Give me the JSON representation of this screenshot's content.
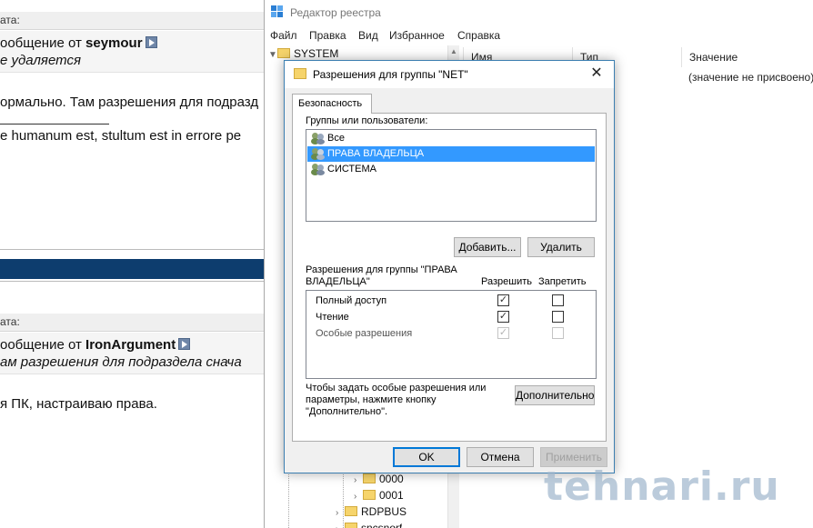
{
  "forum": {
    "post1": {
      "header": "ата:",
      "quote_prefix": "ообщение от",
      "author": "seymour",
      "quote_text": "е удаляется",
      "body": "ормально. Там разрешения для подразд",
      "signature": "е humanum est, stultum est in errore pe"
    },
    "post2": {
      "header": "ата:",
      "quote_prefix": "ообщение от",
      "author": "IronArgument",
      "quote_text": "ам разрешения для подраздела снача",
      "body": "я ПК, настраиваю права."
    }
  },
  "regedit": {
    "title": "Редактор реестра",
    "menu": [
      "Файл",
      "Правка",
      "Вид",
      "Избранное",
      "Справка"
    ],
    "tree": {
      "root": "SYSTEM",
      "items": [
        "0000",
        "0001",
        "RDPBUS",
        "sncsnorf"
      ]
    },
    "columns": [
      "Имя",
      "Тип",
      "Значение"
    ],
    "row_value": "(значение не присвоено)"
  },
  "dialog": {
    "title": "Разрешения для группы \"NET\"",
    "tab": "Безопасность",
    "groups_label": "Группы или пользователи:",
    "groups": [
      {
        "name": "Все",
        "selected": false
      },
      {
        "name": "ПРАВА ВЛАДЕЛЬЦА",
        "selected": true
      },
      {
        "name": "СИСТЕМА",
        "selected": false
      }
    ],
    "add_button": "Добавить...",
    "remove_button": "Удалить",
    "perm_label_line1": "Разрешения для группы \"ПРАВА",
    "perm_label_line2": "ВЛАДЕЛЬЦА\"",
    "allow_label": "Разрешить",
    "deny_label": "Запретить",
    "permissions": [
      {
        "name": "Полный доступ",
        "allow": true,
        "deny": false,
        "enabled": true
      },
      {
        "name": "Чтение",
        "allow": true,
        "deny": false,
        "enabled": true
      },
      {
        "name": "Особые разрешения",
        "allow": true,
        "deny": false,
        "enabled": false
      }
    ],
    "advanced_text_line1": "Чтобы задать особые разрешения или",
    "advanced_text_line2": "параметры, нажмите кнопку",
    "advanced_text_line3": "\"Дополнительно\".",
    "advanced_button": "Дополнительно",
    "ok_button": "OK",
    "cancel_button": "Отмена",
    "apply_button": "Применить",
    "close_glyph": "✕"
  },
  "watermark": "tehnari.ru",
  "colors": {
    "selection": "#3399ff",
    "dark_band": "#0d3d6e",
    "dialog_border": "#3c7fb1"
  }
}
